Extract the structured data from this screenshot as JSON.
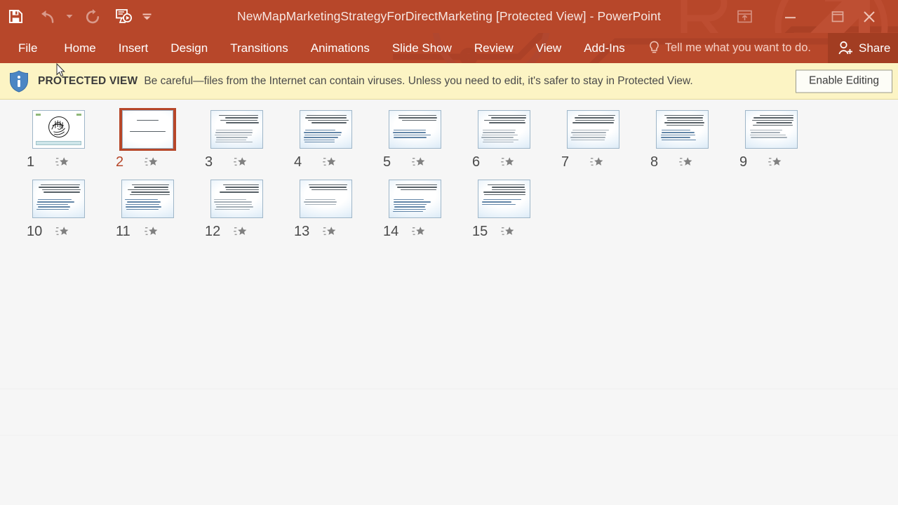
{
  "window": {
    "title": "NewMapMarketingStrategyForDirectMarketing [Protected View] - PowerPoint",
    "quick_access": [
      {
        "name": "save",
        "icon": "save-icon",
        "enabled": true
      },
      {
        "name": "undo",
        "icon": "undo-icon",
        "enabled": false
      },
      {
        "name": "undo-dropdown",
        "icon": "chevron-down-icon",
        "enabled": false
      },
      {
        "name": "redo",
        "icon": "redo-icon",
        "enabled": false
      },
      {
        "name": "start-from-beginning",
        "icon": "start-slideshow-icon",
        "enabled": true
      },
      {
        "name": "customize-quick-access-toolbar",
        "icon": "chevron-down-icon",
        "enabled": true
      }
    ],
    "controls": [
      {
        "name": "ribbon-display-options",
        "icon": "ribbon-display-icon"
      },
      {
        "name": "minimize",
        "icon": "minimize-icon"
      },
      {
        "name": "restore",
        "icon": "maximize-icon"
      },
      {
        "name": "close",
        "icon": "close-icon"
      }
    ]
  },
  "ribbon": {
    "tabs": [
      {
        "label": "File"
      },
      {
        "label": "Home"
      },
      {
        "label": "Insert"
      },
      {
        "label": "Design"
      },
      {
        "label": "Transitions"
      },
      {
        "label": "Animations"
      },
      {
        "label": "Slide Show"
      },
      {
        "label": "Review"
      },
      {
        "label": "View"
      },
      {
        "label": "Add-Ins"
      }
    ],
    "tell_me": "Tell me what you want to do.",
    "share_label": "Share"
  },
  "protected_view": {
    "badge": "PROTECTED VIEW",
    "message": "Be careful—files from the Internet can contain viruses. Unless you need to edit, it's safer to stay in Protected View.",
    "enable_button": "Enable Editing"
  },
  "colors": {
    "accent": "#b7472a",
    "share_bg": "#a23d22",
    "protected_bar_bg": "#fcf4c4",
    "workspace_bg": "#f6f6f6",
    "selection": "#b7472a"
  },
  "slide_sorter": {
    "selected_slide": 2,
    "slides": [
      {
        "number": "1",
        "star": "star-icon",
        "style": "title-image"
      },
      {
        "number": "2",
        "star": "star-icon",
        "style": "centered-text",
        "lines": [
          "In The name Of God"
        ]
      },
      {
        "number": "3",
        "star": "star-icon",
        "style": "heading-body"
      },
      {
        "number": "4",
        "star": "star-icon",
        "style": "heading-body"
      },
      {
        "number": "5",
        "star": "star-icon",
        "style": "heading-body"
      },
      {
        "number": "6",
        "star": "star-icon",
        "style": "heading-body"
      },
      {
        "number": "7",
        "star": "star-icon",
        "style": "heading-body"
      },
      {
        "number": "8",
        "star": "star-icon",
        "style": "heading-body"
      },
      {
        "number": "9",
        "star": "star-icon",
        "style": "heading-body"
      },
      {
        "number": "10",
        "star": "star-icon",
        "style": "heading-body"
      },
      {
        "number": "11",
        "star": "star-icon",
        "style": "heading-body"
      },
      {
        "number": "12",
        "star": "star-icon",
        "style": "heading-body"
      },
      {
        "number": "13",
        "star": "star-icon",
        "style": "heading-body"
      },
      {
        "number": "14",
        "star": "star-icon",
        "style": "heading-body"
      },
      {
        "number": "15",
        "star": "star-icon",
        "style": "heading-body"
      }
    ]
  }
}
